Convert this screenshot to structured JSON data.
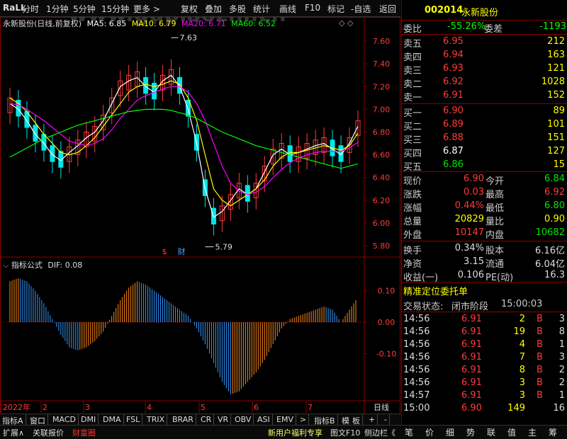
{
  "toolbar": {
    "logo": "RaLL",
    "items": [
      "分时",
      "1分钟",
      "5分钟",
      "15分钟",
      "更多 >",
      "复权",
      "叠加",
      "多股",
      "统计",
      "画线",
      "F10",
      "标记",
      "-自选",
      "返回"
    ]
  },
  "chart_header": {
    "stock_label": "永新股份(日线,前复权)",
    "ma5_label": "MA5: 6.85",
    "ma10_label": "MA10: 6.79",
    "ma20_label": "MA20: 6.71",
    "ma60_label": "MA60: 6.52",
    "watermark": "www.gupiaozhi.cn",
    "ma5_color": "#ffffff",
    "ma10_color": "#ffff00",
    "ma20_color": "#ff00ff",
    "ma60_color": "#00ff00"
  },
  "price_axis": {
    "ticks": [
      "7.60",
      "7.40",
      "7.20",
      "7.00",
      "6.80",
      "6.60",
      "6.40",
      "6.20",
      "6.00",
      "5.80"
    ],
    "high_label": "7.63",
    "low_label": "5.79",
    "event_labels": [
      "$",
      "财"
    ]
  },
  "indicator": {
    "title": "指标公式",
    "dif_label": "DIF: 0.08",
    "ticks": [
      "0.10",
      "0.00",
      "-0.10"
    ],
    "up_color": "#ff8c1a",
    "down_color": "#3399ff"
  },
  "date_axis": {
    "labels": [
      "2022年",
      "2",
      "3",
      "4",
      "5",
      "6",
      "7"
    ],
    "period": "日线"
  },
  "tabs": [
    "指标A",
    "窗口",
    "MACD",
    "DMI",
    "DMA",
    "FSL",
    "TRIX",
    "BRAR",
    "CR",
    "VR",
    "OBV",
    "ASI",
    "EMV",
    ">",
    "指标B",
    "模",
    "板",
    "+",
    "-"
  ],
  "status_bar": {
    "left": [
      "扩展∧",
      "关联报价",
      "财富圈"
    ],
    "right": [
      "新用户福利专享",
      "图文F10",
      "侧边栏《"
    ],
    "quote_tabs": [
      "笔",
      "价",
      "细",
      "势",
      "联",
      "值",
      "主",
      "筹"
    ]
  },
  "quote": {
    "code": "002014",
    "name": "永新股份",
    "weibi_label": "委比",
    "weibi": "-55.26%",
    "weicha_label": "委差",
    "weicha": "-1193",
    "asks": [
      {
        "label": "卖五",
        "price": "6.95",
        "vol": "212"
      },
      {
        "label": "卖四",
        "price": "6.94",
        "vol": "163"
      },
      {
        "label": "卖三",
        "price": "6.93",
        "vol": "121"
      },
      {
        "label": "卖二",
        "price": "6.92",
        "vol": "1028"
      },
      {
        "label": "卖一",
        "price": "6.91",
        "vol": "152"
      }
    ],
    "bids": [
      {
        "label": "买一",
        "price": "6.90",
        "vol": "89"
      },
      {
        "label": "买二",
        "price": "6.89",
        "vol": "101"
      },
      {
        "label": "买三",
        "price": "6.88",
        "vol": "151"
      },
      {
        "label": "买四",
        "price": "6.87",
        "vol": "127"
      },
      {
        "label": "买五",
        "price": "6.86",
        "vol": "15"
      }
    ],
    "stats": [
      {
        "l1": "现价",
        "v1": "6.90",
        "l2": "今开",
        "v2": "6.84"
      },
      {
        "l1": "涨跌",
        "v1": "0.03",
        "l2": "最高",
        "v2": "6.92"
      },
      {
        "l1": "涨幅",
        "v1": "0.44%",
        "l2": "最低",
        "v2": "6.80"
      },
      {
        "l1": "总量",
        "v1": "20829",
        "l2": "量比",
        "v2": "0.90"
      },
      {
        "l1": "外盘",
        "v1": "10147",
        "l2": "内盘",
        "v2": "10682"
      }
    ],
    "fundamentals": [
      {
        "l1": "换手",
        "v1": "0.34%",
        "l2": "股本",
        "v2": "6.16亿"
      },
      {
        "l1": "净资",
        "v1": "3.15",
        "l2": "流通",
        "v2": "6.04亿"
      },
      {
        "l1": "收益(一)",
        "v1": "0.106",
        "l2": "PE(动)",
        "v2": "16.3"
      }
    ],
    "order_title": "精准定位委托单",
    "trade_state_label": "交易状态:",
    "trade_state": "闭市阶段",
    "trade_time": "15:00:03",
    "ticks": [
      {
        "t": "14:56",
        "p": "6.91",
        "v": "2",
        "s": "B",
        "n": "3"
      },
      {
        "t": "14:56",
        "p": "6.91",
        "v": "19",
        "s": "B",
        "n": "8"
      },
      {
        "t": "14:56",
        "p": "6.91",
        "v": "4",
        "s": "B",
        "n": "1"
      },
      {
        "t": "14:56",
        "p": "6.91",
        "v": "7",
        "s": "B",
        "n": "3"
      },
      {
        "t": "14:56",
        "p": "6.91",
        "v": "8",
        "s": "B",
        "n": "2"
      },
      {
        "t": "14:56",
        "p": "6.91",
        "v": "3",
        "s": "B",
        "n": "2"
      },
      {
        "t": "14:57",
        "p": "6.91",
        "v": "3",
        "s": "B",
        "n": "1"
      },
      {
        "t": "15:00",
        "p": "6.90",
        "v": "149",
        "s": "",
        "n": "16"
      }
    ]
  },
  "chart_data": {
    "type": "line",
    "title": "永新股份(日线,前复权)",
    "xlabel": "",
    "ylabel": "",
    "ylim": [
      5.75,
      7.7
    ],
    "x_tick_labels": [
      "2022年",
      "2",
      "3",
      "4",
      "5",
      "6",
      "7"
    ],
    "series": [
      {
        "name": "MA5",
        "values": [
          7.05,
          7.0,
          6.9,
          6.78,
          6.7,
          6.6,
          6.55,
          6.62,
          6.68,
          6.75,
          6.8,
          6.9,
          7.05,
          7.2,
          7.25,
          7.28,
          7.2,
          7.15,
          7.25,
          7.3,
          7.2,
          7.0,
          6.7,
          6.3,
          6.05,
          6.1,
          6.2,
          6.3,
          6.25,
          6.3,
          6.45,
          6.6,
          6.65,
          6.6,
          6.62,
          6.65,
          6.68,
          6.7,
          6.65,
          6.6,
          6.7,
          6.85
        ]
      },
      {
        "name": "MA10",
        "values": [
          7.1,
          7.05,
          6.98,
          6.88,
          6.78,
          6.7,
          6.62,
          6.6,
          6.62,
          6.68,
          6.75,
          6.85,
          6.95,
          7.05,
          7.15,
          7.2,
          7.22,
          7.2,
          7.22,
          7.25,
          7.22,
          7.1,
          6.9,
          6.6,
          6.3,
          6.2,
          6.15,
          6.2,
          6.25,
          6.3,
          6.38,
          6.5,
          6.58,
          6.62,
          6.62,
          6.64,
          6.66,
          6.68,
          6.66,
          6.64,
          6.68,
          6.79
        ]
      },
      {
        "name": "MA20",
        "values": [
          7.05,
          7.04,
          7.0,
          6.95,
          6.9,
          6.84,
          6.78,
          6.72,
          6.7,
          6.68,
          6.7,
          6.74,
          6.82,
          6.92,
          7.0,
          7.08,
          7.12,
          7.15,
          7.18,
          7.2,
          7.2,
          7.15,
          7.05,
          6.9,
          6.7,
          6.5,
          6.35,
          6.28,
          6.25,
          6.27,
          6.32,
          6.4,
          6.47,
          6.53,
          6.57,
          6.6,
          6.62,
          6.63,
          6.63,
          6.63,
          6.66,
          6.71
        ]
      },
      {
        "name": "MA60",
        "values": [
          6.58,
          6.62,
          6.66,
          6.7,
          6.74,
          6.77,
          6.8,
          6.83,
          6.86,
          6.88,
          6.9,
          6.92,
          6.94,
          6.96,
          6.98,
          6.99,
          7.0,
          7.0,
          7.0,
          6.99,
          6.97,
          6.95,
          6.92,
          6.88,
          6.84,
          6.8,
          6.77,
          6.74,
          6.71,
          6.68,
          6.66,
          6.64,
          6.62,
          6.6,
          6.58,
          6.56,
          6.54,
          6.52,
          6.5,
          6.48,
          6.5,
          6.52
        ]
      }
    ],
    "macd": [
      0.13,
      0.14,
      0.13,
      0.1,
      0.06,
      0.01,
      -0.04,
      -0.08,
      -0.09,
      -0.08,
      -0.06,
      -0.03,
      0.02,
      0.07,
      0.11,
      0.13,
      0.12,
      0.1,
      0.08,
      0.06,
      0.04,
      0.02,
      -0.02,
      -0.07,
      -0.13,
      -0.19,
      -0.23,
      -0.22,
      -0.19,
      -0.16,
      -0.12,
      -0.07,
      -0.02,
      0.01,
      0.02,
      0.03,
      0.04,
      0.05,
      0.04,
      0.0,
      0.04,
      0.08
    ],
    "macd_ylim": [
      -0.25,
      0.16
    ]
  }
}
